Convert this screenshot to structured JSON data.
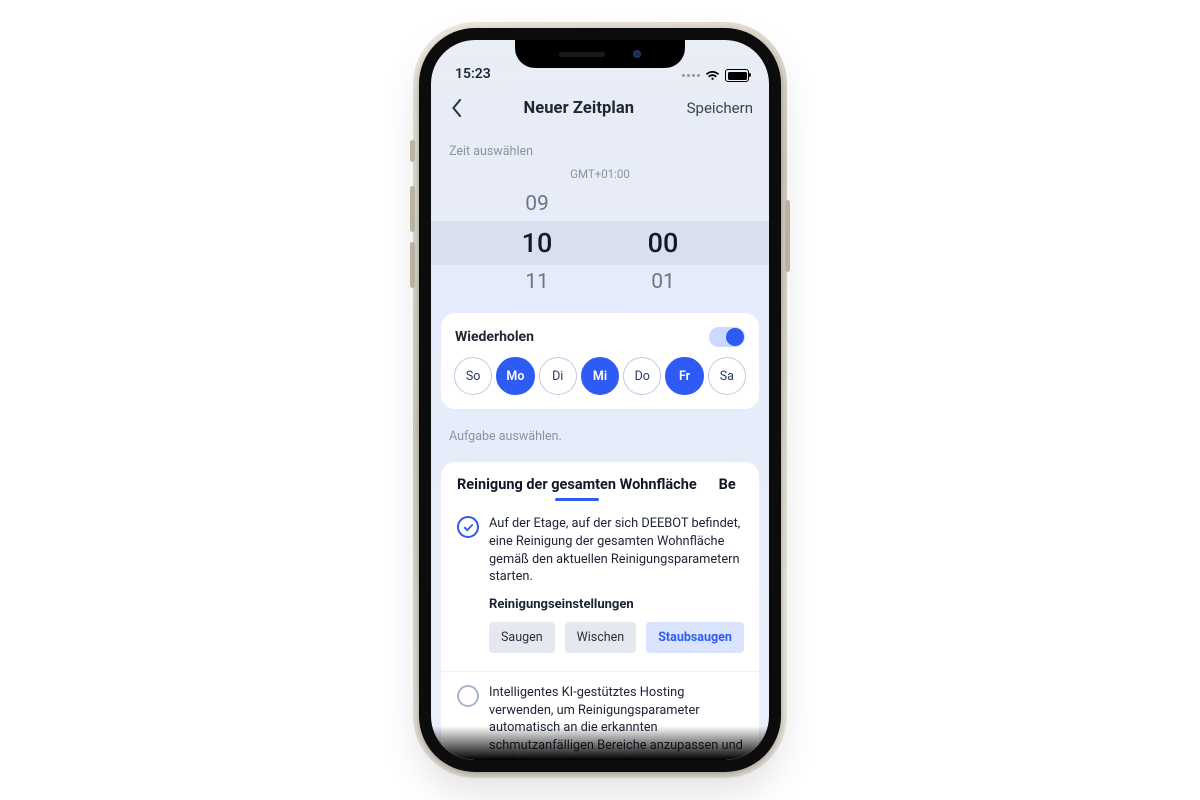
{
  "status": {
    "time": "15:23"
  },
  "nav": {
    "title": "Neuer Zeitplan",
    "save": "Speichern"
  },
  "time_section": {
    "label": "Zeit auswählen",
    "timezone": "GMT+01:00",
    "hour_prev": "09",
    "hour_sel": "10",
    "hour_next": "11",
    "min_prev": "",
    "min_sel": "00",
    "min_next": "01"
  },
  "repeat": {
    "label": "Wiederholen",
    "enabled": true,
    "days": [
      {
        "abbr": "So",
        "selected": false
      },
      {
        "abbr": "Mo",
        "selected": true
      },
      {
        "abbr": "Di",
        "selected": false
      },
      {
        "abbr": "Mi",
        "selected": true
      },
      {
        "abbr": "Do",
        "selected": false
      },
      {
        "abbr": "Fr",
        "selected": true
      },
      {
        "abbr": "Sa",
        "selected": false
      }
    ]
  },
  "task_section": {
    "label": "Aufgabe auswählen."
  },
  "tabs": {
    "active": "Reinigung der gesamten Wohnfläche",
    "next_peek": "Be"
  },
  "option_full": {
    "text": "Auf der Etage, auf der sich DEEBOT befindet, eine Reinigung der gesamten Wohnfläche gemäß den aktuellen Reinigungsparametern starten.",
    "settings_label": "Reinigungseinstellungen",
    "modes": [
      {
        "label": "Saugen",
        "selected": false
      },
      {
        "label": "Wischen",
        "selected": false
      },
      {
        "label": "Staubsaugen",
        "selected": true
      }
    ]
  },
  "option_ai": {
    "text": "Intelligentes KI-gestütztes Hosting verwenden, um Reinigungsparameter automatisch an die erkannten schmutzanfälligen Bereiche anzupassen und die Reinigung der gesamten"
  }
}
